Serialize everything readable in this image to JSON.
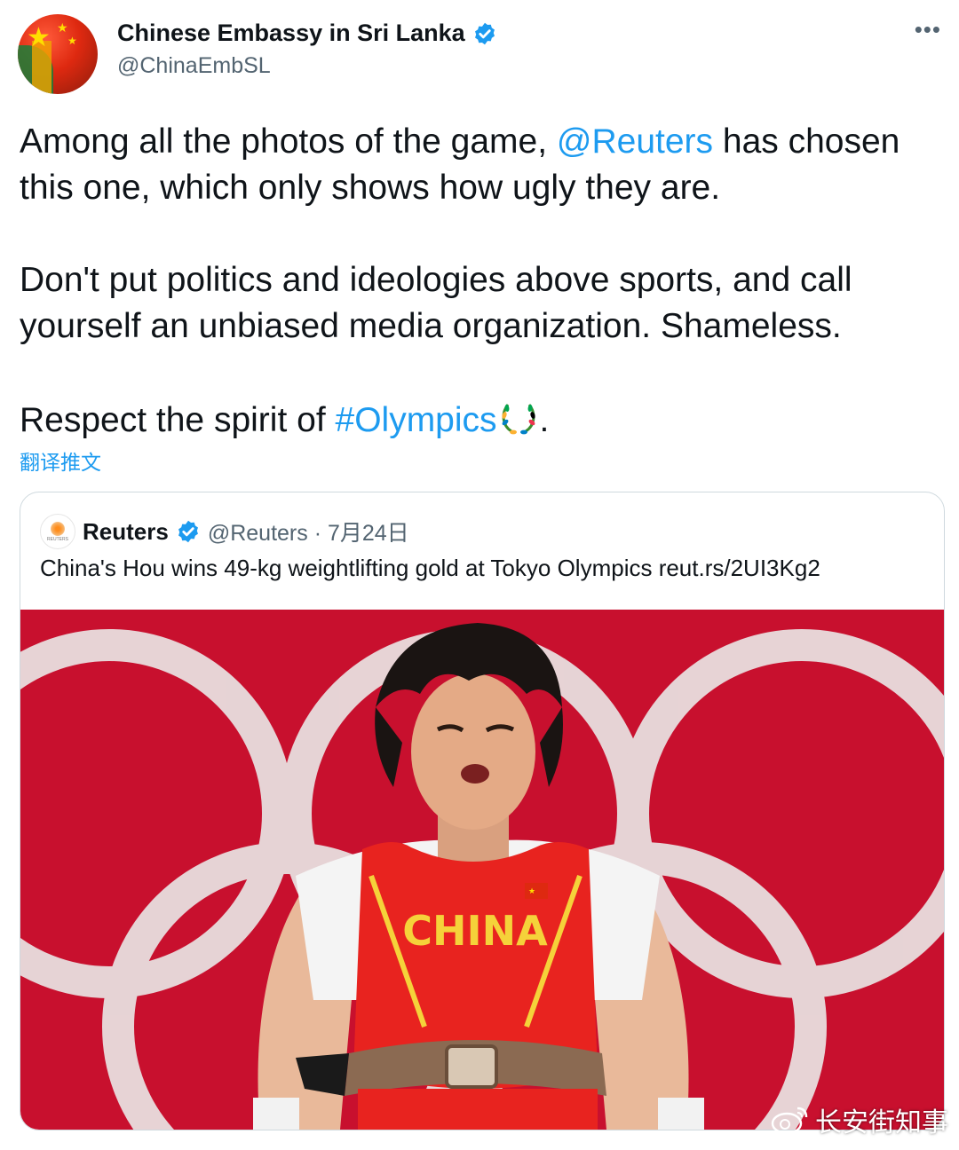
{
  "tweet": {
    "author_name": "Chinese Embassy in Sri Lanka",
    "author_handle": "@ChinaEmbSL",
    "more_label": "•••",
    "text": {
      "p1_before": "Among all the photos of the game, ",
      "p1_mention": "@Reuters",
      "p1_after": " has chosen this one, which only shows how ugly they are.",
      "p2": "Don't put politics and ideologies above sports, and call yourself an unbiased media organization. Shameless.",
      "p3_before": "Respect the spirit of ",
      "p3_hashtag": "#Olympics",
      "p3_after": "."
    },
    "translate_label": "翻译推文"
  },
  "quoted": {
    "avatar_text": "REUTERS",
    "name": "Reuters",
    "handle_date": "@Reuters · 7月24日",
    "text": "China's Hou wins 49-kg weightlifting gold at Tokyo Olympics reut.rs/2UI3Kg2",
    "photo_jersey_text": "CHINA"
  },
  "watermark": "长安街知事",
  "colors": {
    "link": "#1d9bf0",
    "verified": "#1d9bf0",
    "photo_background": "#c8102e",
    "jersey": "#e8231f",
    "jersey_text": "#f5d23a"
  },
  "icons": [
    "verified-badge-icon",
    "more-icon",
    "olympic-wreath-icon",
    "weibo-icon"
  ]
}
